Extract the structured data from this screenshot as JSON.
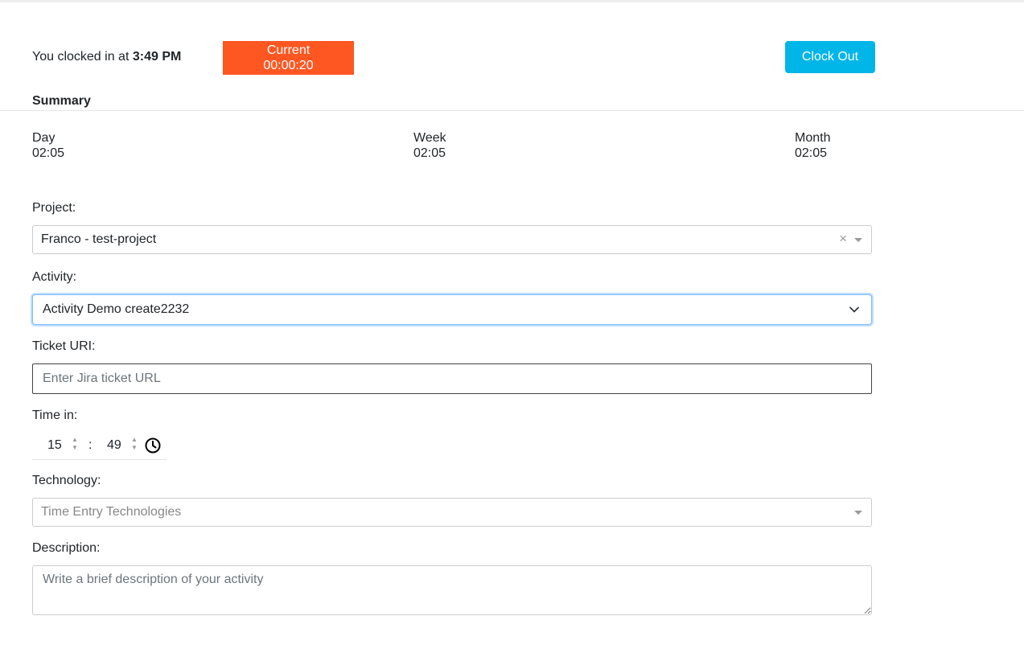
{
  "header": {
    "clocked_prefix": "You clocked in at",
    "clocked_time": "3:49 PM",
    "current_label": "Current",
    "current_timer": "00:00:20",
    "clock_out_label": "Clock Out"
  },
  "summary": {
    "title": "Summary",
    "day_label": "Day",
    "day_value": "02:05",
    "week_label": "Week",
    "week_value": "02:05",
    "month_label": "Month",
    "month_value": "02:05"
  },
  "form": {
    "project_label": "Project:",
    "project_value": "Franco - test-project",
    "activity_label": "Activity:",
    "activity_value": "Activity Demo create2232",
    "ticket_label": "Ticket URI:",
    "ticket_placeholder": "Enter Jira ticket URL",
    "time_in_label": "Time in:",
    "time_in_hour": "15",
    "time_in_minute": "49",
    "time_separator": ":",
    "technology_label": "Technology:",
    "technology_placeholder": "Time Entry Technologies",
    "description_label": "Description:",
    "description_placeholder": "Write a brief description of your activity"
  },
  "icons": {
    "clear": "×",
    "spin_up": "▲",
    "spin_down": "▼"
  },
  "colors": {
    "current_bg": "#ff5722",
    "clock_out_bg": "#00b5e8",
    "focus_border": "#80bdff"
  }
}
